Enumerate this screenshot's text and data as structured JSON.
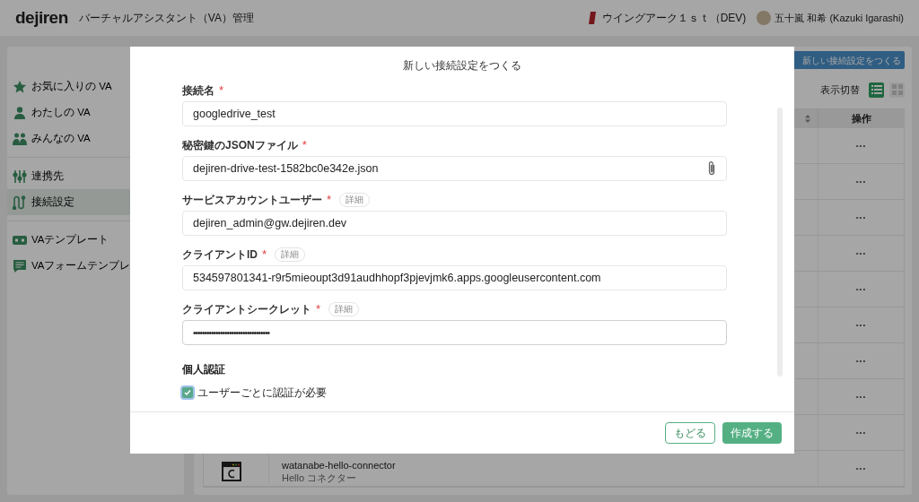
{
  "header": {
    "logo": "dejiren",
    "app_title": "バーチャルアシスタント（VA）管理",
    "organization": "ウイングアーク１ｓｔ（DEV)",
    "user": "五十嵐 和希 (Kazuki Igarashi)"
  },
  "sidebar": {
    "groups": [
      [
        {
          "label": "お気に入りの VA",
          "kind": "star",
          "selected": false
        },
        {
          "label": "わたしの VA",
          "kind": "person",
          "selected": false
        },
        {
          "label": "みんなの VA",
          "kind": "people",
          "selected": false
        }
      ],
      [
        {
          "label": "連携先",
          "kind": "sliders",
          "selected": false
        },
        {
          "label": "接続設定",
          "kind": "route",
          "selected": true
        }
      ],
      [
        {
          "label": "VAテンプレート",
          "kind": "template",
          "selected": false
        },
        {
          "label": "VAフォームテンプレ",
          "kind": "form",
          "selected": false
        }
      ]
    ]
  },
  "main": {
    "new_button": "新しい接続設定をつくる",
    "view_toggle": {
      "label": "表示切替",
      "modes": [
        {
          "kind": "list",
          "selected": true
        },
        {
          "kind": "grid",
          "selected": false
        }
      ]
    },
    "table": {
      "action_column": "操作",
      "rows": [
        {
          "action": "•••"
        },
        {
          "action": "•••"
        },
        {
          "action": "•••"
        },
        {
          "action": "•••"
        },
        {
          "action": "•••"
        },
        {
          "action": "•••"
        },
        {
          "action": "•••"
        },
        {
          "action": "•••"
        },
        {
          "action": "•••"
        },
        {
          "name": "watanabe-hello-connector",
          "description": "Hello コネクター",
          "action": "•••"
        }
      ]
    }
  },
  "dialog": {
    "title": "新しい接続設定をつくる",
    "fields": [
      {
        "label": "接続名",
        "required_mark": "*",
        "kind": "text",
        "value": "googledrive_test"
      },
      {
        "label": "秘密鍵のJSONファイル",
        "required_mark": "*",
        "kind": "file",
        "value": "dejiren-drive-test-1582bc0e342e.json"
      },
      {
        "label": "サービスアカウントユーザー",
        "required_mark": "*",
        "kind": "text",
        "detail": "詳細",
        "value": "dejiren_admin@gw.dejiren.dev"
      },
      {
        "label": "クライアントID",
        "required_mark": "*",
        "kind": "text",
        "detail": "詳細",
        "value": "534597801341-r9r5mieoupt3d91audhhopf3pjevjmk6.apps.googleusercontent.com"
      },
      {
        "label": "クライアントシークレット",
        "required_mark": "*",
        "kind": "password",
        "detail": "詳細",
        "value": "••••••••••••••••••••••••••••••••••"
      }
    ],
    "section": "個人認証",
    "checkbox": {
      "label": "ユーザーごとに認証が必要",
      "checked": true
    },
    "buttons": [
      {
        "label": "もどる",
        "kind": "secondary"
      },
      {
        "label": "作成する",
        "kind": "primary"
      }
    ]
  }
}
